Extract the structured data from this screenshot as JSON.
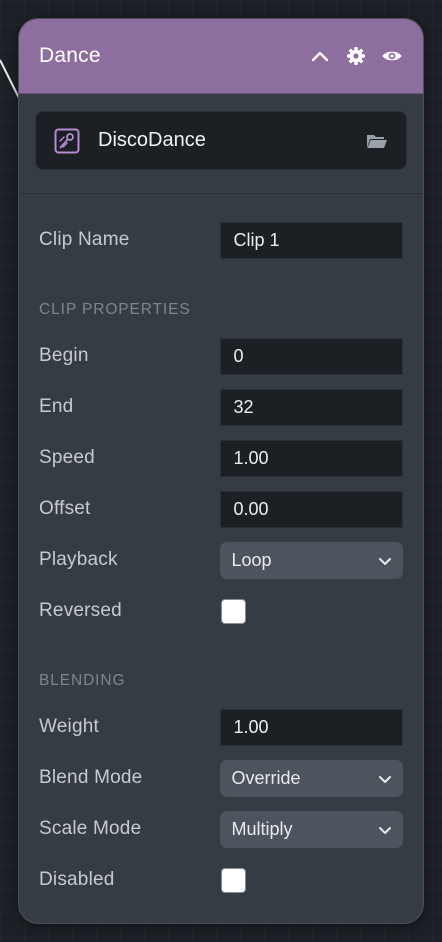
{
  "panel": {
    "title": "Dance",
    "icons": [
      "chevron-up-icon",
      "gear-icon",
      "eye-icon"
    ]
  },
  "asset": {
    "name": "DiscoDance",
    "icon": "animation-clip-icon",
    "browse_icon": "folder-icon"
  },
  "clip": {
    "name_label": "Clip Name",
    "name_value": "Clip 1"
  },
  "clip_properties": {
    "section_title": "CLIP PROPERTIES",
    "begin_label": "Begin",
    "begin_value": "0",
    "end_label": "End",
    "end_value": "32",
    "speed_label": "Speed",
    "speed_value": "1.00",
    "offset_label": "Offset",
    "offset_value": "0.00",
    "playback_label": "Playback",
    "playback_value": "Loop",
    "reversed_label": "Reversed",
    "reversed_checked": false
  },
  "blending": {
    "section_title": "BLENDING",
    "weight_label": "Weight",
    "weight_value": "1.00",
    "blend_mode_label": "Blend Mode",
    "blend_mode_value": "Override",
    "scale_mode_label": "Scale Mode",
    "scale_mode_value": "Multiply",
    "disabled_label": "Disabled",
    "disabled_checked": false
  },
  "colors": {
    "header": "#8e6d9f",
    "panel": "#363c44",
    "field": "#1c1f24",
    "select": "#4d545d",
    "accent": "#b58ad6"
  }
}
